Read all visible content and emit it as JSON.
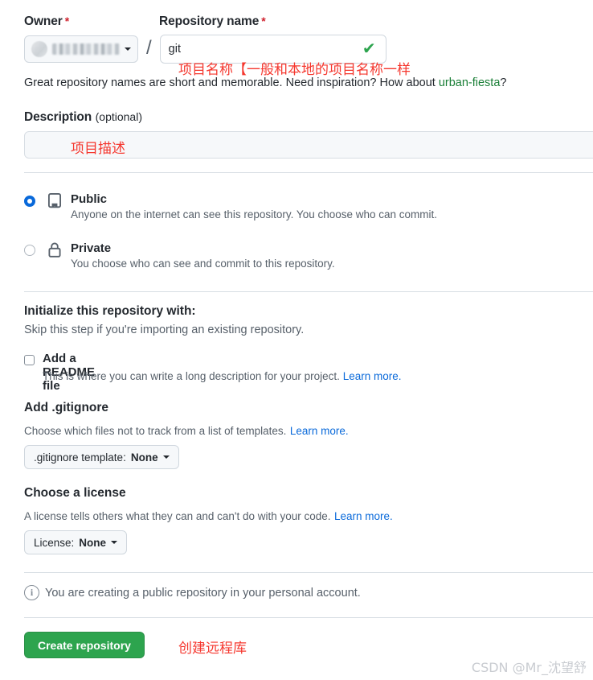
{
  "owner": {
    "label": "Owner",
    "required_mark": "*",
    "selected_value": "",
    "caret_icon": "chevron-down-icon",
    "avatar_icon": "avatar"
  },
  "repo_name": {
    "label": "Repository name",
    "required_mark": "*",
    "value": "git",
    "placeholder": "",
    "valid_icon": "check-icon",
    "annotation": "项目名称【一般和本地的项目名称一样"
  },
  "separator": "/",
  "help": {
    "prefix": "Great repository names are short and memorable. Need inspiration? How about ",
    "suggestion": "urban-fiesta",
    "suffix": "?"
  },
  "description": {
    "label": "Description",
    "optional_label": "(optional)",
    "value": "",
    "placeholder": "",
    "annotation": "项目描述"
  },
  "visibility": {
    "options": [
      {
        "id": "public",
        "title": "Public",
        "description": "Anyone on the internet can see this repository. You choose who can commit.",
        "selected": true,
        "icon": "repo-book-icon"
      },
      {
        "id": "private",
        "title": "Private",
        "description": "You choose who can see and commit to this repository.",
        "selected": false,
        "icon": "lock-icon"
      }
    ]
  },
  "initialize": {
    "title": "Initialize this repository with:",
    "subtitle": "Skip this step if you're importing an existing repository.",
    "readme": {
      "label": "Add a README file",
      "description": "This is where you can write a long description for your project.",
      "learn_more": "Learn more.",
      "checked": false
    }
  },
  "gitignore": {
    "title": "Add .gitignore",
    "description": "Choose which files not to track from a list of templates.",
    "learn_more": "Learn more.",
    "button_label": ".gitignore template:",
    "button_value": "None",
    "caret_icon": "chevron-down-icon"
  },
  "license": {
    "title": "Choose a license",
    "description": "A license tells others what they can and can't do with your code.",
    "learn_more": "Learn more.",
    "button_label": "License:",
    "button_value": "None",
    "caret_icon": "chevron-down-icon"
  },
  "info_notice": {
    "icon": "info-icon",
    "text": "You are creating a public repository in your personal account."
  },
  "submit": {
    "label": "Create repository",
    "annotation": "创建远程库"
  },
  "watermark": "CSDN @Mr_沈望舒",
  "colors": {
    "accent_green": "#2da44e",
    "link_blue": "#0969da",
    "link_green": "#1a7f37",
    "annotation_red": "#f5372e",
    "required_red": "#cf222e",
    "radio_blue": "#0969da",
    "border": "#d0d7de",
    "muted_text": "#57606a",
    "text": "#24292f"
  }
}
